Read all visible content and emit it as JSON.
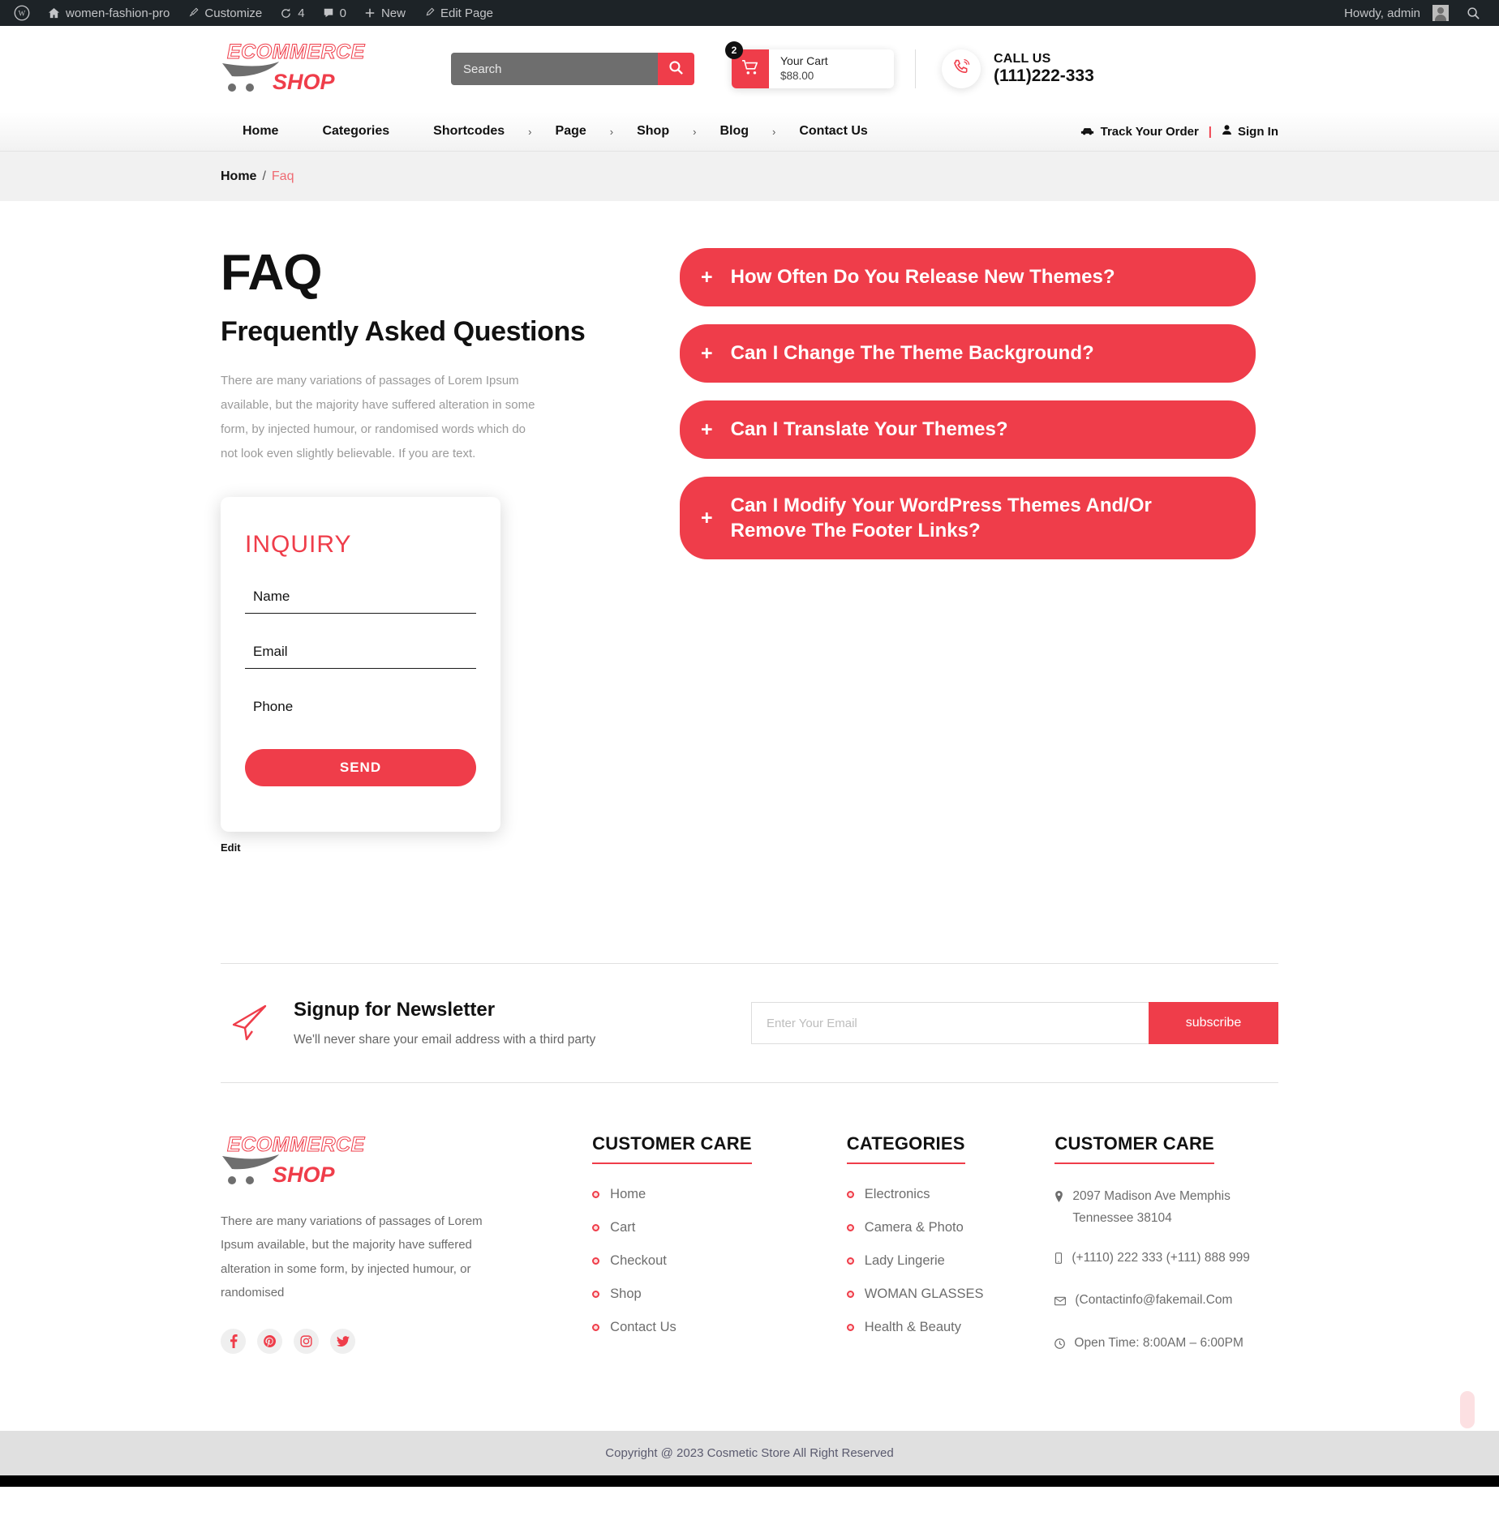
{
  "adminbar": {
    "site_name": "women-fashion-pro",
    "customize": "Customize",
    "updates_count": "4",
    "comments_count": "0",
    "new": "New",
    "edit_page": "Edit Page",
    "howdy": "Howdy, admin"
  },
  "header": {
    "logo_primary": "ECOMMERCE",
    "logo_secondary": "SHOP",
    "search_placeholder": "Search",
    "search_value": "",
    "cart_badge": "2",
    "cart_title": "Your Cart",
    "cart_price": "$88.00",
    "call_label": "CALL US",
    "call_number": "(111)222-333"
  },
  "nav": {
    "items": [
      {
        "label": "Home",
        "caret": false
      },
      {
        "label": "Categories",
        "caret": false
      },
      {
        "label": "Shortcodes",
        "caret": true
      },
      {
        "label": "Page",
        "caret": true
      },
      {
        "label": "Shop",
        "caret": true
      },
      {
        "label": "Blog",
        "caret": true
      },
      {
        "label": "Contact Us",
        "caret": false
      }
    ],
    "track_order": "Track Your Order",
    "separator": "|",
    "sign_in": "Sign In"
  },
  "breadcrumb": {
    "home": "Home",
    "separator": "/",
    "current": "Faq"
  },
  "main": {
    "title": "FAQ",
    "subtitle": "Frequently Asked Questions",
    "description": "There are many variations of passages of Lorem Ipsum available, but the majority have suffered alteration in some form, by injected humour, or randomised words which do not look even slightly believable. If you are text.",
    "inquiry": {
      "title": "INQUIRY",
      "name_placeholder": "Name",
      "name_value": "",
      "email_placeholder": "Email",
      "email_value": "",
      "phone_placeholder": "Phone",
      "phone_value": "",
      "send_label": "SEND",
      "edit_label": "Edit"
    },
    "faqs": [
      {
        "icon": "plus",
        "question": "How Often Do You Release New Themes?"
      },
      {
        "icon": "plus",
        "question": "Can I Change The Theme Background?"
      },
      {
        "icon": "plus",
        "question": "Can I Translate Your Themes?"
      },
      {
        "icon": "plus",
        "question": "Can I Modify Your WordPress Themes And/Or Remove The Footer Links?"
      }
    ]
  },
  "newsletter": {
    "title": "Signup for Newsletter",
    "subtitle": "We'll never share your email address with a third party",
    "input_placeholder": "Enter Your Email",
    "input_value": "",
    "button_label": "subscribe"
  },
  "footer": {
    "logo_primary": "ECOMMERCE",
    "logo_secondary": "SHOP",
    "description": "There are many variations of passages of Lorem Ipsum available, but the majority have suffered alteration in some form, by injected humour, or randomised",
    "socials": [
      {
        "name": "facebook-icon"
      },
      {
        "name": "pinterest-icon"
      },
      {
        "name": "instagram-icon"
      },
      {
        "name": "twitter-icon"
      }
    ],
    "care": {
      "heading": "CUSTOMER CARE",
      "items": [
        "Home",
        "Cart",
        "Checkout",
        "Shop",
        "Contact Us"
      ]
    },
    "categories": {
      "heading": "CATEGORIES",
      "items": [
        "Electronics",
        "Camera & Photo",
        "Lady Lingerie",
        "WOMAN GLASSES",
        "Health & Beauty"
      ]
    },
    "contact": {
      "heading": "CUSTOMER CARE",
      "address": "2097 Madison Ave Memphis Tennessee 38104",
      "phone": "(+1110) 222 333 (+111) 888 999",
      "email": "(Contactinfo@fakemail.Com",
      "hours": "Open Time: 8:00AM – 6:00PM"
    }
  },
  "copyright": {
    "text": "Copyright @ 2023 Cosmetic Store All Right Reserved"
  },
  "colors": {
    "accent": "#ef3d4a",
    "adminbar": "#1d2327",
    "breadcrumb_bg": "#f1f1f1",
    "copyright_bg": "#e0e0e0",
    "muted_text": "#6d6d6d"
  }
}
